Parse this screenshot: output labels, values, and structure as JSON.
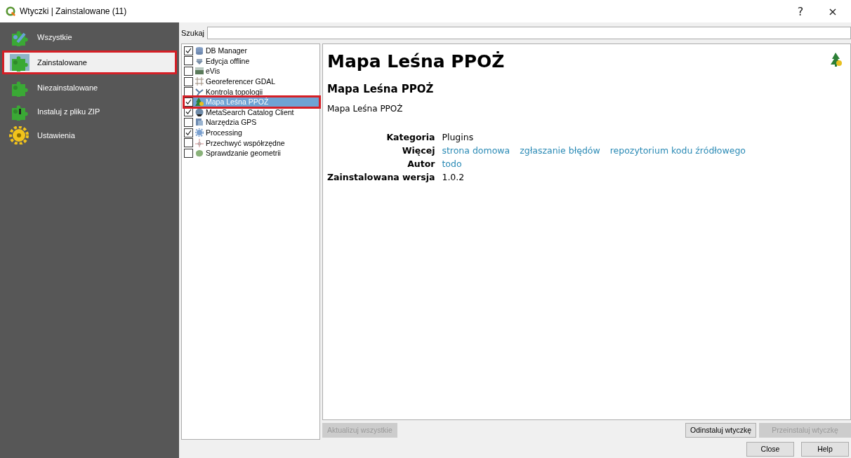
{
  "window": {
    "title": "Wtyczki | Zainstalowane (11)",
    "help": "?",
    "close": "×"
  },
  "sidebar": {
    "items": [
      {
        "label": "Wszystkie",
        "selected": false,
        "highlighted": false
      },
      {
        "label": "Zainstalowane",
        "selected": true,
        "highlighted": true
      },
      {
        "label": "Niezainstalowane",
        "selected": false,
        "highlighted": false
      },
      {
        "label": "Instaluj z pliku ZIP",
        "selected": false,
        "highlighted": false
      },
      {
        "label": "Ustawienia",
        "selected": false,
        "highlighted": false
      }
    ]
  },
  "search": {
    "label": "Szukaj"
  },
  "plugins": [
    {
      "name": "DB Manager",
      "checked": true,
      "selected": false,
      "highlighted": false
    },
    {
      "name": "Edycja offline",
      "checked": false,
      "selected": false,
      "highlighted": false
    },
    {
      "name": "eVis",
      "checked": false,
      "selected": false,
      "highlighted": false
    },
    {
      "name": "Georeferencer GDAL",
      "checked": false,
      "selected": false,
      "highlighted": false
    },
    {
      "name": "Kontrola topologii",
      "checked": false,
      "selected": false,
      "highlighted": false
    },
    {
      "name": "Mapa Leśna PPOŻ",
      "checked": true,
      "selected": true,
      "highlighted": true
    },
    {
      "name": "MetaSearch Catalog Client",
      "checked": true,
      "selected": false,
      "highlighted": false
    },
    {
      "name": "Narzędzia GPS",
      "checked": false,
      "selected": false,
      "highlighted": false
    },
    {
      "name": "Processing",
      "checked": true,
      "selected": false,
      "highlighted": false
    },
    {
      "name": "Przechwyć współrzędne",
      "checked": false,
      "selected": false,
      "highlighted": false
    },
    {
      "name": "Sprawdzanie geometrii",
      "checked": false,
      "selected": false,
      "highlighted": false
    }
  ],
  "details": {
    "title": "Mapa Leśna PPOŻ",
    "subtitle": "Mapa Leśna PPOŻ",
    "description": "Mapa Leśna PPOŻ",
    "fields": [
      {
        "label": "Kategoria",
        "values": [
          {
            "text": "Plugins",
            "kind": "text"
          }
        ]
      },
      {
        "label": "Więcej",
        "values": [
          {
            "text": "strona domowa",
            "kind": "link"
          },
          {
            "text": "zgłaszanie błędów",
            "kind": "link"
          },
          {
            "text": "repozytorium kodu źródłowego",
            "kind": "link"
          }
        ]
      },
      {
        "label": "Autor",
        "values": [
          {
            "text": "todo",
            "kind": "link"
          }
        ]
      },
      {
        "label": "Zainstalowana wersja",
        "values": [
          {
            "text": "1.0.2",
            "kind": "text"
          }
        ]
      }
    ]
  },
  "actions": [
    {
      "label": "Aktualizuj wszystkie",
      "disabled": true,
      "kind": "left"
    },
    {
      "label": "Odinstaluj wtyczkę",
      "disabled": false,
      "kind": "right"
    },
    {
      "label": "Przeinstaluj wtyczkę",
      "disabled": true,
      "kind": "right"
    }
  ],
  "buttons": [
    {
      "label": "Close",
      "disabled": false
    },
    {
      "label": "Help",
      "disabled": false
    }
  ]
}
